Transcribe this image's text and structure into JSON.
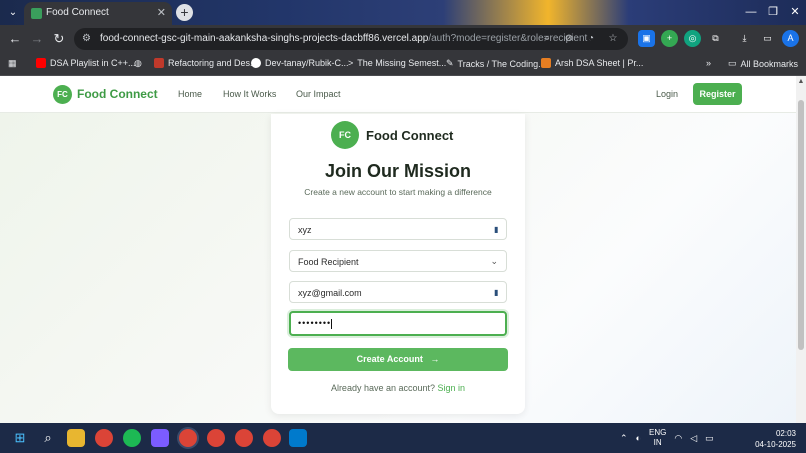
{
  "browser": {
    "tab_title": "Food Connect",
    "new_tab_symbol": "+",
    "url_main": "food-connect-gsc-git-main-aakanksha-singhs-projects-dacbff86.vercel.app",
    "url_query": "/auth?mode=register&role=recipient",
    "profile_initial": "A"
  },
  "bookmarks": [
    "DSA Playlist in C++...",
    "Refactoring and Des...",
    "Dev-tanay/Rubik-C...",
    "The Missing Semest...",
    "Tracks / The Coding...",
    "Arsh DSA Sheet | Pr..."
  ],
  "all_bookmarks": "All Bookmarks",
  "site": {
    "logo_initials": "FC",
    "brand": "Food Connect",
    "nav": [
      "Home",
      "How It Works",
      "Our Impact"
    ],
    "login": "Login",
    "register": "Register"
  },
  "card": {
    "logo_initials": "FC",
    "brand": "Food Connect",
    "title": "Join Our Mission",
    "subtitle": "Create a new account to start making a difference",
    "name_value": "xyz",
    "role_value": "Food Recipient",
    "email_value": "xyz@gmail.com",
    "password_mask": "••••••••",
    "submit": "Create Account",
    "signin_prompt": "Already have an account?",
    "signin_link": "Sign in"
  },
  "taskbar": {
    "lang_line1": "ENG",
    "lang_line2": "IN",
    "time": "02:03",
    "date": "04-10-2025"
  },
  "colors": {
    "accent": "#4caf50",
    "brand_text": "#3e9b45"
  }
}
